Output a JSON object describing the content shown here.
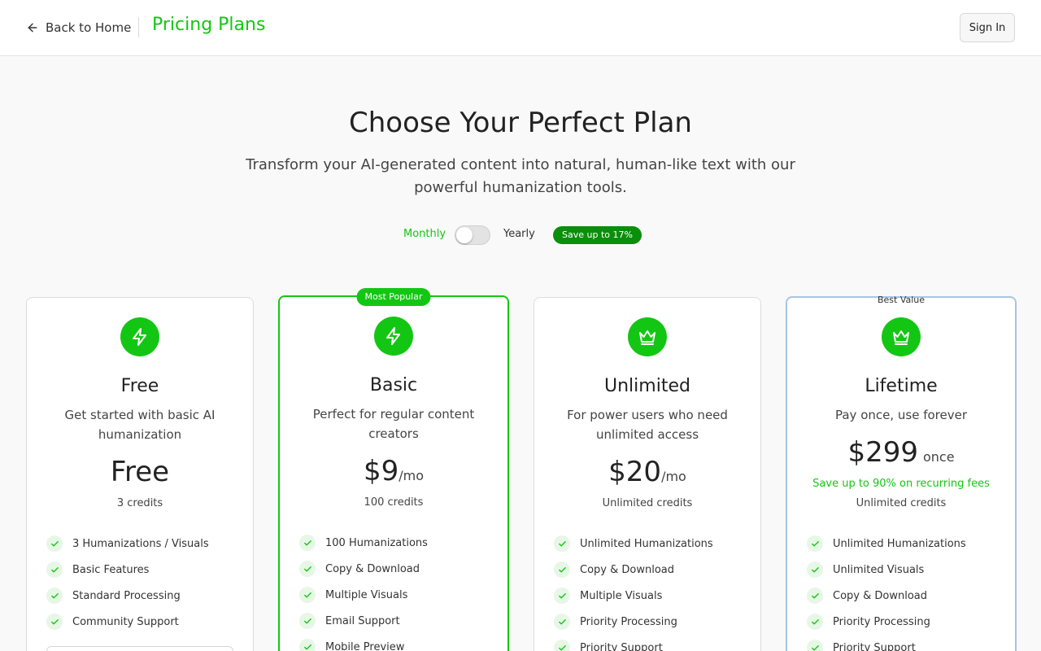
{
  "header": {
    "back_label": "Back to Home",
    "title": "Pricing Plans",
    "signin_label": "Sign In"
  },
  "hero": {
    "title": "Choose Your Perfect Plan",
    "subtitle": "Transform your AI-generated content into natural, human-like text with our powerful humanization tools."
  },
  "billing_toggle": {
    "monthly_label": "Monthly",
    "yearly_label": "Yearly",
    "save_badge": "Save up to 17%",
    "selected": "Monthly"
  },
  "plans": [
    {
      "name": "Free",
      "icon": "zap-icon",
      "description": "Get started with basic AI humanization",
      "price": "Free",
      "price_suffix": "",
      "credits": "3 credits",
      "features": [
        "3 Humanizations / Visuals",
        "Basic Features",
        "Standard Processing",
        "Community Support"
      ]
    },
    {
      "name": "Basic",
      "icon": "zap-icon",
      "badge": "Most Popular",
      "description": "Perfect for regular content creators",
      "price": "$9",
      "price_suffix": "/mo",
      "credits": "100 credits",
      "features": [
        "100 Humanizations",
        "Copy & Download",
        "Multiple Visuals",
        "Email Support",
        "Mobile Preview"
      ]
    },
    {
      "name": "Unlimited",
      "icon": "crown-icon",
      "description": "For power users who need unlimited access",
      "price": "$20",
      "price_suffix": "/mo",
      "credits": "Unlimited credits",
      "features": [
        "Unlimited Humanizations",
        "Copy & Download",
        "Multiple Visuals",
        "Priority Processing",
        "Priority Support"
      ]
    },
    {
      "name": "Lifetime",
      "icon": "crown-icon",
      "badge": "Best Value",
      "description": "Pay once, use forever",
      "price": "$299",
      "price_suffix": "once",
      "save_note": "Save up to 90% on recurring fees",
      "credits": "Unlimited credits",
      "features": [
        "Unlimited Humanizations",
        "Unlimited Visuals",
        "Copy & Download",
        "Priority Processing",
        "Priority Support"
      ]
    }
  ],
  "colors": {
    "accent": "#14c614",
    "badge_dark": "#0a8f0a",
    "best_border": "#a8c4e6"
  }
}
